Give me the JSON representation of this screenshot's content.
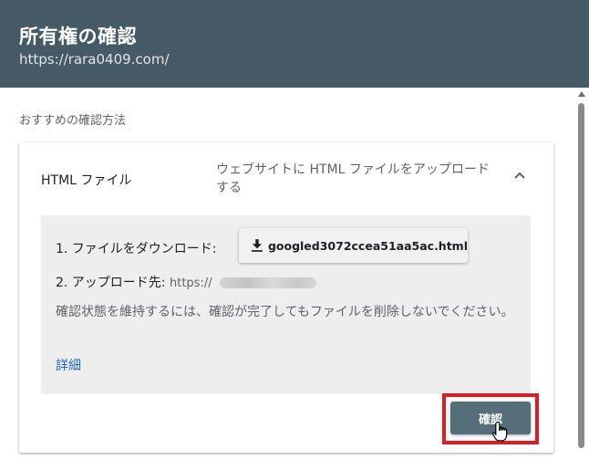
{
  "header": {
    "title": "所有権の確認",
    "url": "https://rara0409.com/"
  },
  "section_label": "おすすめの確認方法",
  "method": {
    "title": "HTML ファイル",
    "description": "ウェブサイトに HTML ファイルをアップロードする",
    "expanded_icon": "chevron-up-icon"
  },
  "steps": {
    "step1_label": "1. ファイルをダウンロード:",
    "download_file": "googled3072ccea51aa5ac.html",
    "step2_label": "2. アップロード先:",
    "step2_url": "https://",
    "note": "確認状態を維持するには、確認が完了してもファイルを削除しないでください。",
    "details_link": "詳細"
  },
  "verify_button": "確認",
  "colors": {
    "header_bg": "#455a64",
    "verify_bg": "#546e7a",
    "link": "#1967d2",
    "highlight": "#e01b24"
  }
}
